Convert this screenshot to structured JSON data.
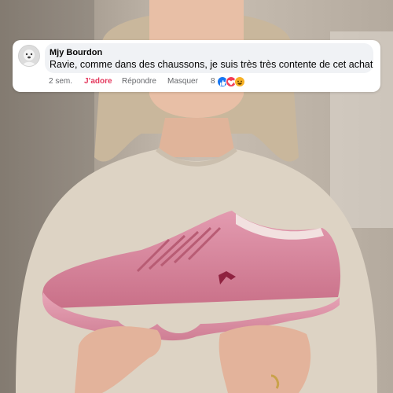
{
  "comment": {
    "author": "Mjy Bourdon",
    "text": "Ravie, comme dans des chaussons, je suis très très contente de cet achat",
    "timestamp": "2 sem.",
    "like_label": "J’adore",
    "reply_label": "Répondre",
    "hide_label": "Masquer",
    "reaction_count": "8",
    "reactions": [
      "like-icon",
      "love-icon",
      "haha-icon"
    ],
    "like_color": "#e4385d"
  },
  "photo": {
    "subject": "woman holding pink sneaker",
    "shoe_color": "#d98a9e",
    "sweater_color": "#ddd3c4"
  }
}
